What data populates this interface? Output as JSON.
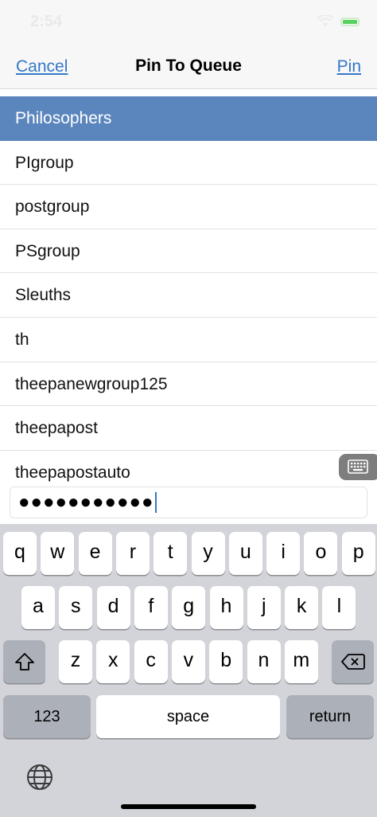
{
  "status_bar": {
    "time": "2:54"
  },
  "nav": {
    "cancel_label": "Cancel",
    "title": "Pin To Queue",
    "pin_label": "Pin"
  },
  "queues": [
    "Philosophers",
    "PIgroup",
    "postgroup",
    "PSgroup",
    "Sleuths",
    "th",
    "theepanewgroup125",
    "theepapost",
    "theepapostauto"
  ],
  "selected_queue": "Philosophers",
  "password": {
    "masked_value": "●●●●●●●●●●●"
  },
  "keyboard": {
    "row1": [
      "q",
      "w",
      "e",
      "r",
      "t",
      "y",
      "u",
      "i",
      "o",
      "p"
    ],
    "row2": [
      "a",
      "s",
      "d",
      "f",
      "g",
      "h",
      "j",
      "k",
      "l"
    ],
    "row3": [
      "z",
      "x",
      "c",
      "v",
      "b",
      "n",
      "m"
    ],
    "numbers_label": "123",
    "space_label": "space",
    "return_label": "return"
  }
}
